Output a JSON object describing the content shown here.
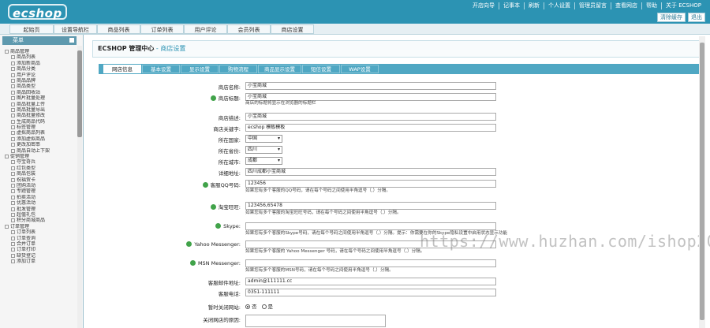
{
  "header": {
    "logo": "ecshop",
    "links": [
      "开店向导",
      "记事本",
      "刷新",
      "个人设置",
      "管理员留言",
      "查看网店",
      "帮助",
      "关于 ECSHOP"
    ],
    "buttons": [
      "清除缓存",
      "退出"
    ]
  },
  "nav": {
    "tabs": [
      "起始页",
      "设置导航栏",
      "商品列表",
      "订单列表",
      "用户评论",
      "会员列表",
      "商店设置"
    ]
  },
  "sidebar": {
    "title": "菜单",
    "groups": [
      {
        "label": "商品管理",
        "items": [
          "商品列表",
          "添加新商品",
          "商品分类",
          "用户评论",
          "商品品牌",
          "商品类型",
          "商品回收站",
          "图片批量处理",
          "商品批量上传",
          "商品批量导出",
          "商品批量修改",
          "生成商品代码",
          "标签管理",
          "虚拟商品列表",
          "添加虚拟商品",
          "更改加密串",
          "商品自动上下架"
        ]
      },
      {
        "label": "促销管理",
        "items": [
          "夺宝奇兵",
          "红包类型",
          "商品包装",
          "祝福贺卡",
          "团购活动",
          "专题管理",
          "拍卖活动",
          "优惠活动",
          "批发管理",
          "超值礼包",
          "积分商城商品"
        ]
      },
      {
        "label": "订单管理",
        "items": [
          "订单列表",
          "订单查询",
          "合并订单",
          "订单打印",
          "缺货登记",
          "添加订单"
        ]
      }
    ]
  },
  "breadcrumb": {
    "title": "ECSHOP 管理中心",
    "sub": " - 商店设置"
  },
  "form_tabs": [
    "网店信息",
    "基本设置",
    "显示设置",
    "购物流程",
    "商品显示设置",
    "短信设置",
    "WAP设置"
  ],
  "fields": [
    {
      "label": "商店名称:",
      "value": "小宝商城",
      "help": false
    },
    {
      "label": "商店标题:",
      "value": "小宝商城",
      "help": true,
      "note": "商店的标题将显示在浏览器的标题栏"
    },
    {
      "label": "商店描述:",
      "value": "小宝商城",
      "help": false
    },
    {
      "label": "商店关键字:",
      "value": "ecshop 模板模板",
      "help": false
    },
    {
      "label": "所在国家:",
      "value": "中国",
      "type": "select",
      "help": false
    },
    {
      "label": "所在省份:",
      "value": "四川",
      "type": "select",
      "help": false
    },
    {
      "label": "所在城市:",
      "value": "成都",
      "type": "select",
      "help": false
    },
    {
      "label": "详细地址:",
      "value": "四川成都小宝商城",
      "help": false
    },
    {
      "label": "客服QQ号码:",
      "value": "123456",
      "help": true,
      "note": "如果您有多个客服的QQ号码，请在每个号码之间使用半角逗号（,）分隔。"
    },
    {
      "label": "淘宝旺旺:",
      "value": "123456,65478",
      "help": true,
      "note": "如果您有多个客服的淘宝旺旺号码，请在每个号码之间使用半角逗号（,）分隔。"
    },
    {
      "label": "Skype:",
      "value": "",
      "help": true,
      "note": "如果您有多个客服的Skype号码，请在每个号码之间使用半角逗号（,）分隔。提示：你需要在你的Skype隐私设置中启用状态显示功能"
    },
    {
      "label": "Yahoo Messenger:",
      "value": "",
      "help": true,
      "note": "如果您有多个客服的 Yahoo Messenger 号码，请在每个号码之间使用半角逗号（,）分隔。"
    },
    {
      "label": "MSN Messenger:",
      "value": "",
      "help": true,
      "note": "如果您有多个客服的MSN号码，请在每个号码之间使用半角逗号（,）分隔。"
    },
    {
      "label": "客服邮件地址:",
      "value": "admin@111111.cc",
      "help": false
    },
    {
      "label": "客服电话:",
      "value": "0351-111111",
      "help": false
    },
    {
      "label": "暂时关闭网站:",
      "type": "radio",
      "options": [
        "否",
        "是"
      ],
      "selected": "否",
      "help": false
    },
    {
      "label": "关闭网店的原因:",
      "value": "",
      "help": false
    }
  ],
  "watermark": "https://www.huzhan.com/ishop20328"
}
